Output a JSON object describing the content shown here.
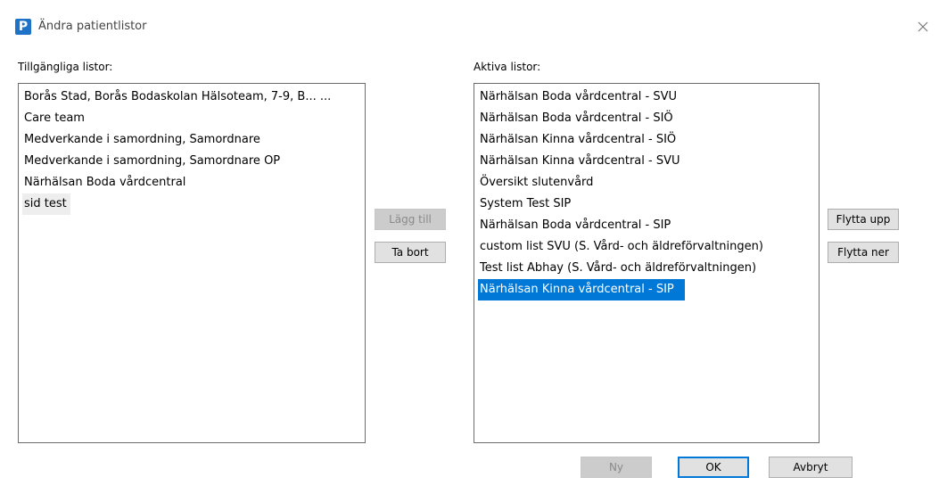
{
  "window": {
    "title": "Ändra patientlistor"
  },
  "available": {
    "label": "Tillgängliga listor:",
    "items": [
      "Borås Stad, Borås Bodaskolan Hälsoteam, 7-9, B...  ...",
      "Care team",
      "Medverkande i samordning, Samordnare",
      "Medverkande i samordning, Samordnare OP",
      "Närhälsan Boda vårdcentral",
      "sid test"
    ],
    "focused_index": 5
  },
  "active": {
    "label": "Aktiva listor:",
    "items": [
      "Närhälsan Boda vårdcentral - SVU",
      "Närhälsan Boda vårdcentral - SIÖ",
      "Närhälsan Kinna vårdcentral - SIÖ",
      "Närhälsan Kinna vårdcentral - SVU",
      "Översikt slutenvård",
      "System Test SIP",
      "Närhälsan Boda vårdcentral - SIP",
      "custom list SVU   (S. Vård- och äldreförvaltningen)",
      "Test list Abhay   (S. Vård- och äldreförvaltningen)",
      "Närhälsan Kinna vårdcentral - SIP"
    ],
    "selected_index": 9
  },
  "buttons": {
    "add": "Lägg till",
    "remove": "Ta bort",
    "move_up": "Flytta upp",
    "move_down": "Flytta ner",
    "new": "Ny",
    "ok": "OK",
    "cancel": "Avbryt"
  },
  "colors": {
    "selection": "#0078d7",
    "app_icon": "#1e73c8"
  },
  "icons": {
    "app": "app-p-icon",
    "close": "close-icon"
  },
  "app_icon_letter": "P"
}
